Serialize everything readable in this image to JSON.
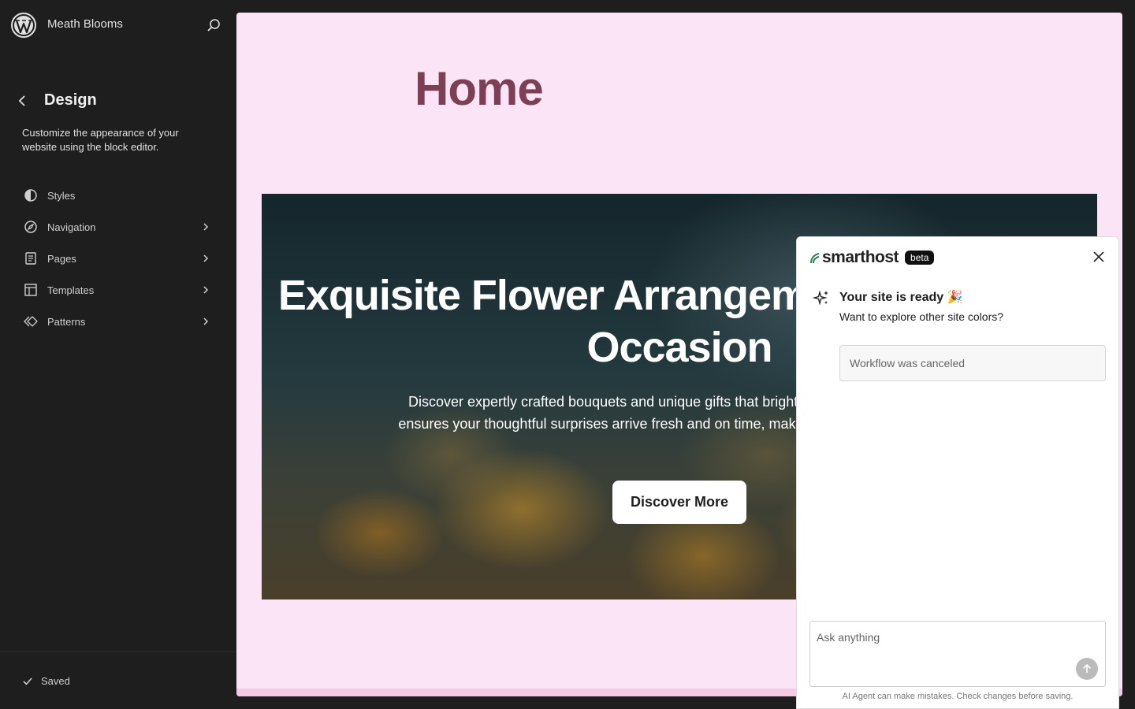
{
  "sidebar": {
    "site_title": "Meath Blooms",
    "section_title": "Design",
    "description": "Customize the appearance of your website using the block editor.",
    "items": [
      {
        "label": "Styles",
        "icon": "half-circle-icon",
        "has_chevron": false
      },
      {
        "label": "Navigation",
        "icon": "compass-icon",
        "has_chevron": true
      },
      {
        "label": "Pages",
        "icon": "page-icon",
        "has_chevron": true
      },
      {
        "label": "Templates",
        "icon": "layout-icon",
        "has_chevron": true
      },
      {
        "label": "Patterns",
        "icon": "diamond-icon",
        "has_chevron": true
      }
    ],
    "footer_status": "Saved"
  },
  "canvas": {
    "page_heading": "Home",
    "hero": {
      "title": "Exquisite Flower Arrangements for Every Occasion",
      "subtitle": "Discover expertly crafted bouquets and unique gifts that brighten any day. Our delivery ensures your thoughtful surprises arrive fresh and on time, making every moment special.",
      "button_label": "Discover More"
    }
  },
  "assistant": {
    "brand": "smarthost",
    "badge": "beta",
    "message_title": "Your site is ready 🎉",
    "message_subtitle": "Want to explore other site colors?",
    "status": "Workflow was canceled",
    "input_placeholder": "Ask anything",
    "disclaimer": "AI Agent can make mistakes. Check changes before saving."
  },
  "colors": {
    "sidebar_bg": "#1e1e1e",
    "canvas_bg": "#fbe4f5",
    "heading_color": "#7c3f55",
    "brand_green": "#2e7d5b"
  }
}
